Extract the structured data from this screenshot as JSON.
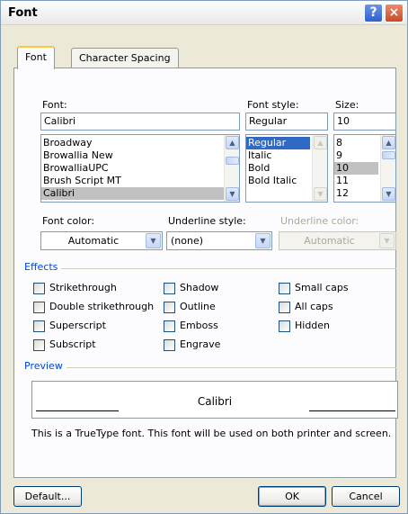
{
  "window": {
    "title": "Font",
    "help_icon": "?",
    "close_icon": "×"
  },
  "tabs": [
    {
      "label": "Font",
      "active": true
    },
    {
      "label": "Character Spacing",
      "active": false
    }
  ],
  "font": {
    "label": "Font:",
    "value": "Calibri",
    "list": [
      "Broadway",
      "Browallia New",
      "BrowalliaUPC",
      "Brush Script MT",
      "Calibri"
    ]
  },
  "font_style": {
    "label": "Font style:",
    "value": "Regular",
    "list": [
      "Regular",
      "Italic",
      "Bold",
      "Bold Italic"
    ]
  },
  "size": {
    "label": "Size:",
    "value": "10",
    "list": [
      "8",
      "9",
      "10",
      "11",
      "12"
    ]
  },
  "font_color": {
    "label": "Font color:",
    "value": "Automatic"
  },
  "underline_style": {
    "label": "Underline style:",
    "value": "(none)"
  },
  "underline_color": {
    "label": "Underline color:",
    "value": "Automatic"
  },
  "effects": {
    "label": "Effects",
    "items": [
      "Strikethrough",
      "Double strikethrough",
      "Superscript",
      "Subscript",
      "Shadow",
      "Outline",
      "Emboss",
      "Engrave",
      "Small caps",
      "All caps",
      "Hidden"
    ]
  },
  "preview": {
    "label": "Preview",
    "text": "Calibri",
    "note": "This is a TrueType font. This font will be used on both printer and screen."
  },
  "buttons": {
    "default": "Default...",
    "ok": "OK",
    "cancel": "Cancel"
  },
  "colors": {
    "accent": "#316ac5",
    "group_label": "#0046d5",
    "tab_highlight": "#ffc73c",
    "face": "#ece9d8"
  }
}
